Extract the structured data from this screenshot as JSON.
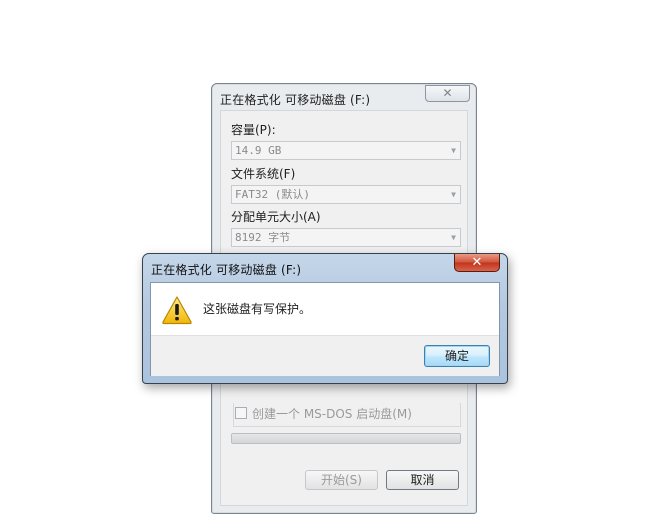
{
  "format_dialog": {
    "title": "正在格式化 可移动磁盘 (F:)",
    "close_glyph": "✕",
    "capacity": {
      "label": "容量(P):",
      "value": "14.9 GB"
    },
    "file_system": {
      "label": "文件系统(F)",
      "value": "FAT32 (默认)"
    },
    "allocation_unit": {
      "label": "分配单元大小(A)",
      "value": "8192 字节"
    },
    "dos_startup_checkbox": {
      "label": "创建一个 MS-DOS 启动盘(M)",
      "checked": false
    },
    "progress": 0,
    "start_button": "开始(S)",
    "cancel_button": "取消"
  },
  "message_box": {
    "title": "正在格式化 可移动磁盘 (F:)",
    "close_glyph": "✕",
    "icon": "warning-icon",
    "message": "这张磁盘有写保护。",
    "ok_button": "确定"
  },
  "colors": {
    "message_titlebar": "#b4c9e0",
    "close_button_red": "#c0341c",
    "ok_button_blue": "#a7d9f5",
    "warning_yellow": "#f7c418"
  }
}
